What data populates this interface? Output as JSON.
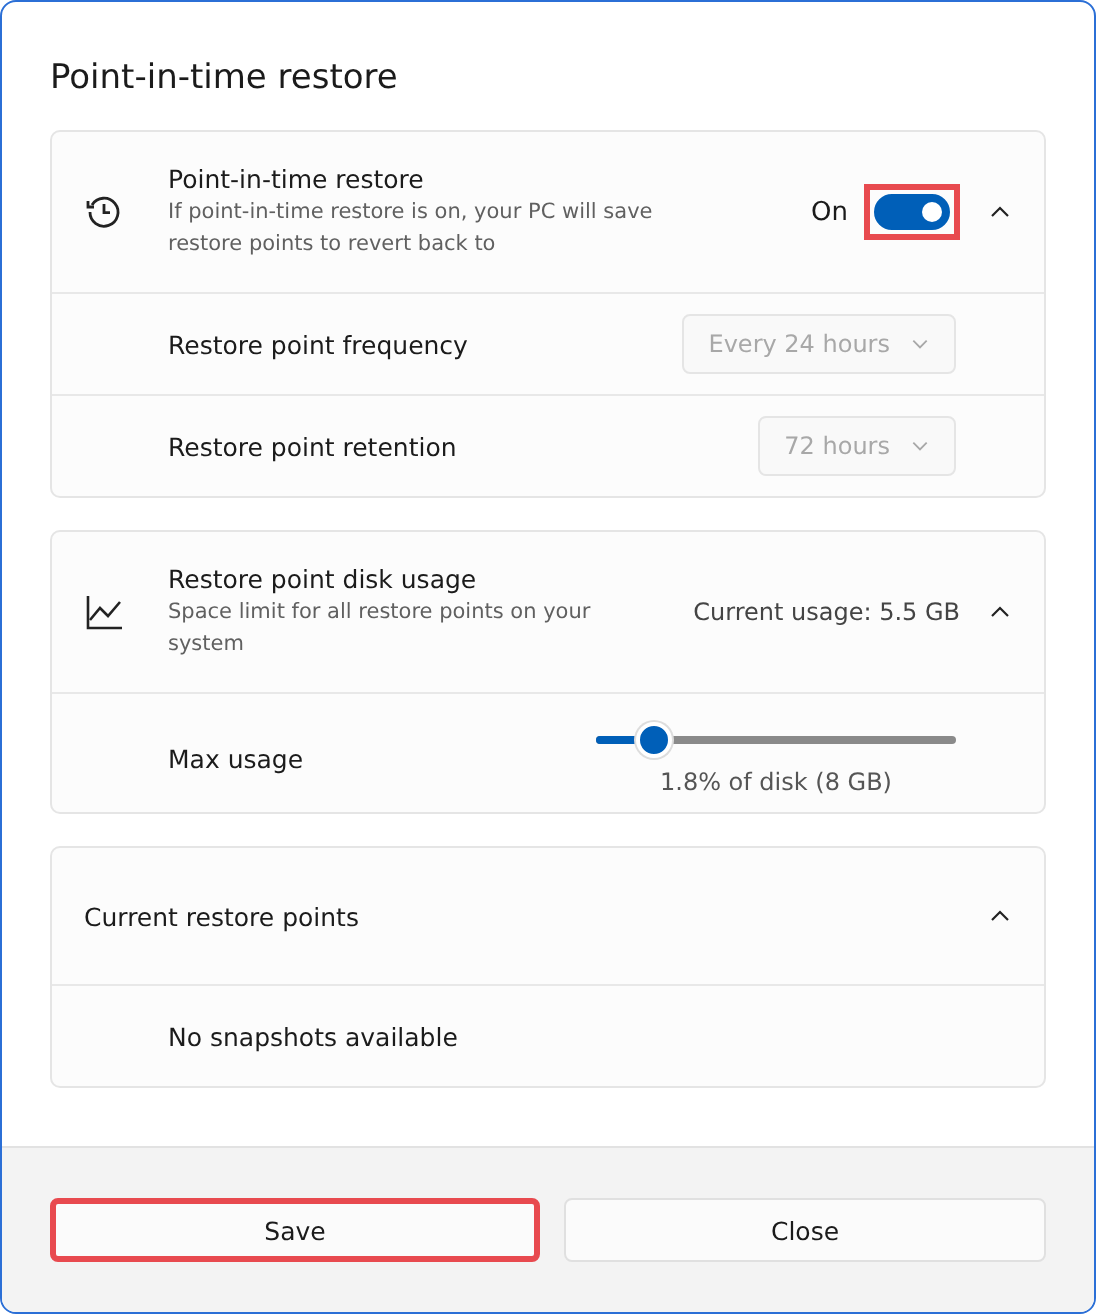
{
  "dialog": {
    "title": "Point-in-time restore"
  },
  "sections": [
    {
      "kind": "toggle",
      "title": "Point-in-time restore",
      "description": "If point-in-time restore is on, your PC will save restore points to revert back to",
      "toggle_label": "On",
      "on": true,
      "highlighted": true,
      "expanded": true,
      "rows": [
        {
          "kind": "dropdown",
          "label": "Restore point frequency",
          "value": "Every 24 hours",
          "disabled": true
        },
        {
          "kind": "dropdown",
          "label": "Restore point retention",
          "value": "72 hours",
          "disabled": true
        }
      ]
    },
    {
      "kind": "info",
      "title": "Restore point disk usage",
      "description": "Space limit for all restore points on your system",
      "info": "Current usage: 5.5 GB",
      "expanded": true,
      "rows": [
        {
          "kind": "slider",
          "label": "Max usage",
          "level": 0.16,
          "reading": "1.8% of disk (8 GB)"
        }
      ]
    },
    {
      "kind": "plain",
      "title": "Current restore points",
      "expanded": true,
      "rows": [
        {
          "kind": "message",
          "label": "No snapshots available"
        }
      ]
    }
  ],
  "buttons": [
    {
      "label": "Save",
      "highlighted": true
    },
    {
      "label": "Close",
      "highlighted": false
    }
  ]
}
